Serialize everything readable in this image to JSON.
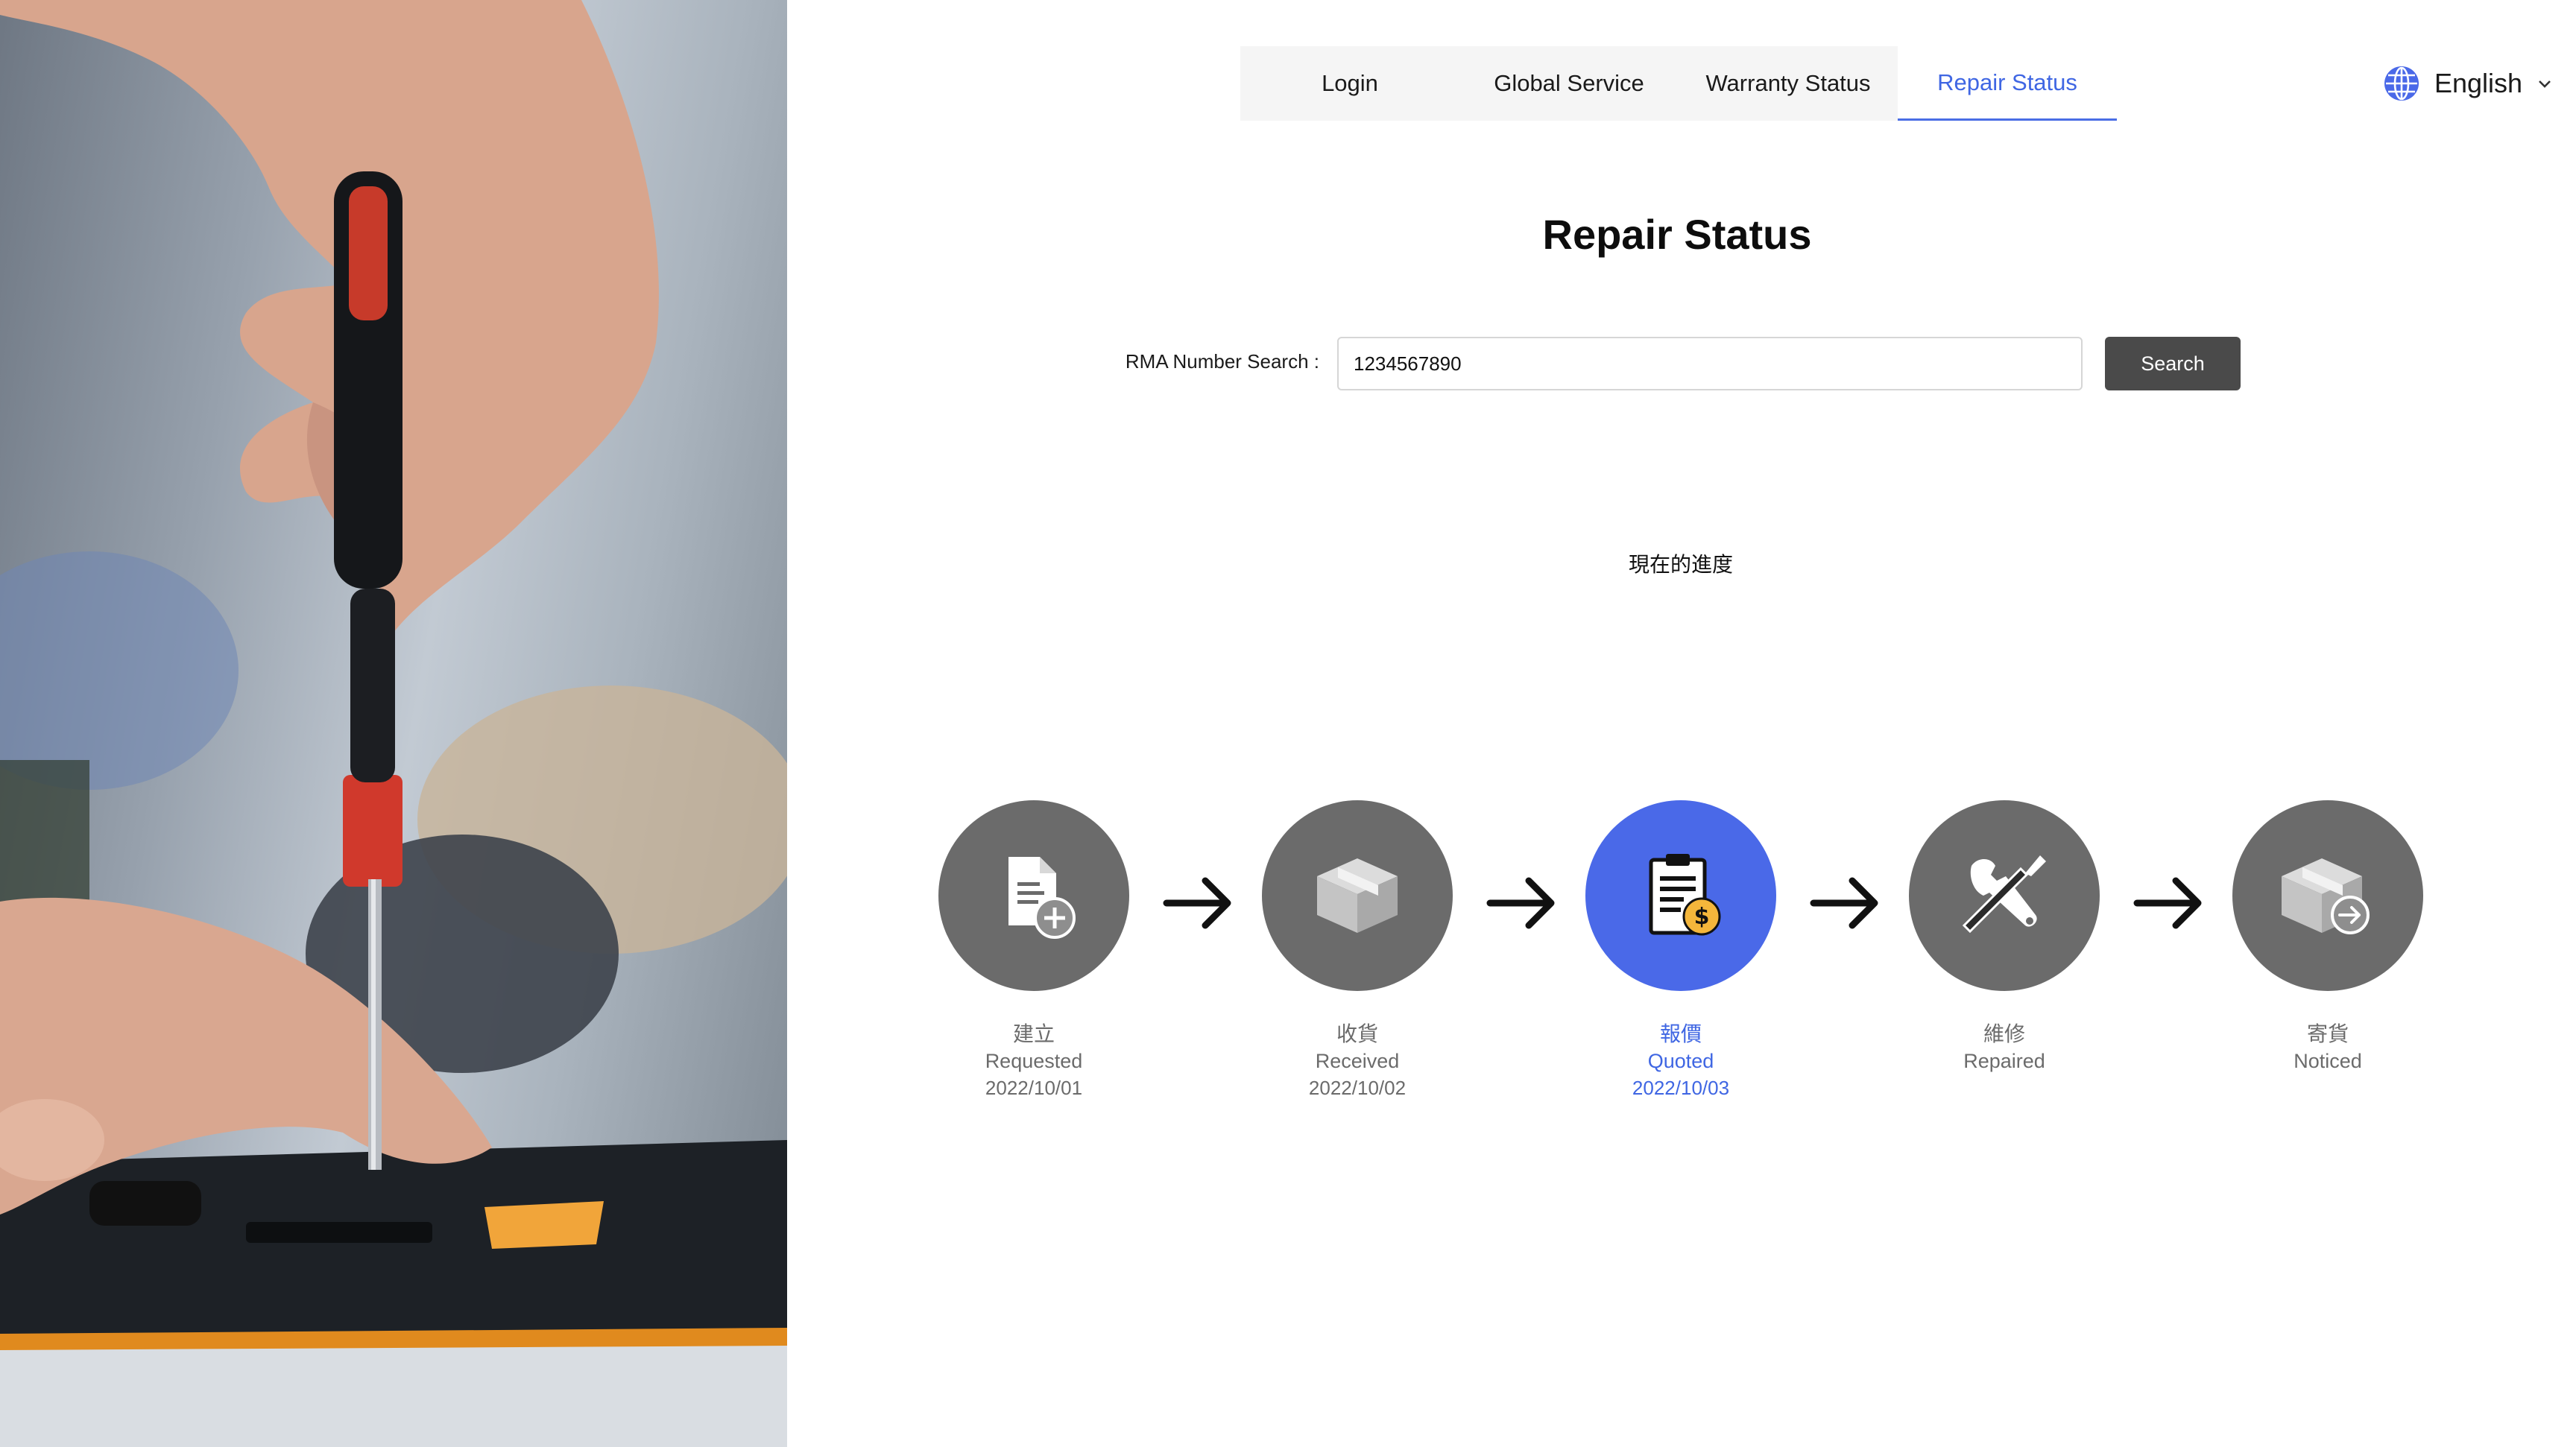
{
  "nav": {
    "tabs": [
      {
        "label": "Login",
        "active": false
      },
      {
        "label": "Global Service",
        "active": false
      },
      {
        "label": "Warranty Status",
        "active": false
      },
      {
        "label": "Repair Status",
        "active": true
      }
    ]
  },
  "language": {
    "label": "English",
    "icon": "globe-icon"
  },
  "page": {
    "title": "Repair Status"
  },
  "search": {
    "label": "RMA Number Search :",
    "value": "1234567890",
    "button_label": "Search"
  },
  "progress": {
    "heading": "現在的進度",
    "steps": [
      {
        "zh": "建立",
        "en": "Requested",
        "date": "2022/10/01",
        "icon": "document-add-icon"
      },
      {
        "zh": "收貨",
        "en": "Received",
        "date": "2022/10/02",
        "icon": "package-box-icon"
      },
      {
        "zh": "報價",
        "en": "Quoted",
        "date": "2022/10/03",
        "icon": "clipboard-dollar-icon",
        "active": true
      },
      {
        "zh": "維修",
        "en": "Repaired",
        "date": "",
        "icon": "wrench-screwdriver-icon"
      },
      {
        "zh": "寄貨",
        "en": "Noticed",
        "date": "",
        "icon": "package-ship-icon"
      }
    ]
  },
  "colors": {
    "accent": "#4a69e8",
    "step_inactive": "#6b6b6b",
    "button": "#4a4a4a",
    "nav_background": "#f5f5f5"
  }
}
